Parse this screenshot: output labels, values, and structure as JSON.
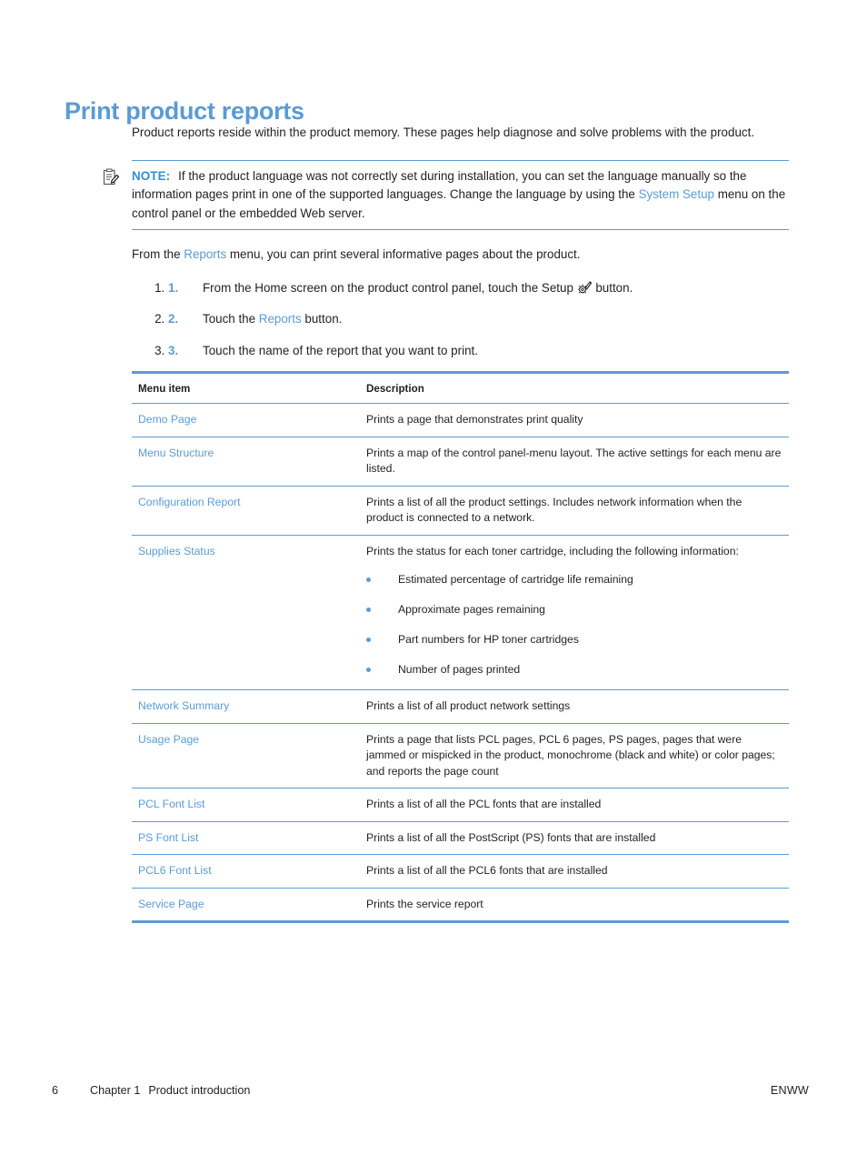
{
  "document": {
    "title": "Print product reports",
    "intro": "Product reports reside within the product memory. These pages help diagnose and solve problems with the product."
  },
  "note": {
    "icon": "note-clipboard-icon",
    "label": "NOTE:",
    "text_part1": "If the product language was not correctly set during installation, you can set the language manually so the information pages print in one of the supported languages. Change the language by using the ",
    "link": "System Setup",
    "text_part2": " menu on the control panel or the embedded Web server."
  },
  "lead_in": {
    "before_link": "From the ",
    "link": "Reports",
    "after_link": " menu, you can print several informative pages about the product."
  },
  "steps": [
    {
      "number": "1.",
      "text_before": "From the Home screen on the product control panel, touch the Setup ",
      "icon": "setup-wrench-gear-icon",
      "text_after": " button."
    },
    {
      "number": "2.",
      "text_before": "Touch the ",
      "link": "Reports",
      "text_after": " button."
    },
    {
      "number": "3.",
      "text_before": "Touch the name of the report that you want to print.",
      "link": "",
      "text_after": ""
    }
  ],
  "table": {
    "headers": [
      "Menu item",
      "Description"
    ],
    "rows": [
      {
        "item": "Demo Page",
        "description": "Prints a page that demonstrates print quality"
      },
      {
        "item": "Menu Structure",
        "description": "Prints a map of the control panel-menu layout. The active settings for each menu are listed."
      },
      {
        "item": "Configuration Report",
        "description": "Prints a list of all the product settings. Includes network information when the product is connected to a network."
      },
      {
        "item": "Supplies Status",
        "description": "Prints the status for each toner cartridge, including the following information:",
        "bullets": [
          "Estimated percentage of cartridge life remaining",
          "Approximate pages remaining",
          "Part numbers for HP toner cartridges",
          "Number of pages printed"
        ]
      },
      {
        "item": "Network Summary",
        "description": "Prints a list of all product network settings"
      },
      {
        "item": "Usage Page",
        "description": "Prints a page that lists PCL pages, PCL 6 pages, PS pages, pages that were jammed or mispicked in the product, monochrome (black and white) or color pages; and reports the page count"
      },
      {
        "item": "PCL Font List",
        "description": "Prints a list of all the PCL fonts that are installed"
      },
      {
        "item": "PS Font List",
        "description": "Prints a list of all the PostScript (PS) fonts that are installed"
      },
      {
        "item": "PCL6 Font List",
        "description": "Prints a list of all the PCL6 fonts that are installed"
      },
      {
        "item": "Service Page",
        "description": "Prints the service report"
      }
    ]
  },
  "footer": {
    "page_number": "6",
    "chapter": "Chapter 1",
    "chapter_title": "Product introduction",
    "edition": "ENWW"
  },
  "colors": {
    "accent_blue": "#5b9bd5",
    "note_blue": "#2f8fd0",
    "body_text": "#231f20"
  }
}
